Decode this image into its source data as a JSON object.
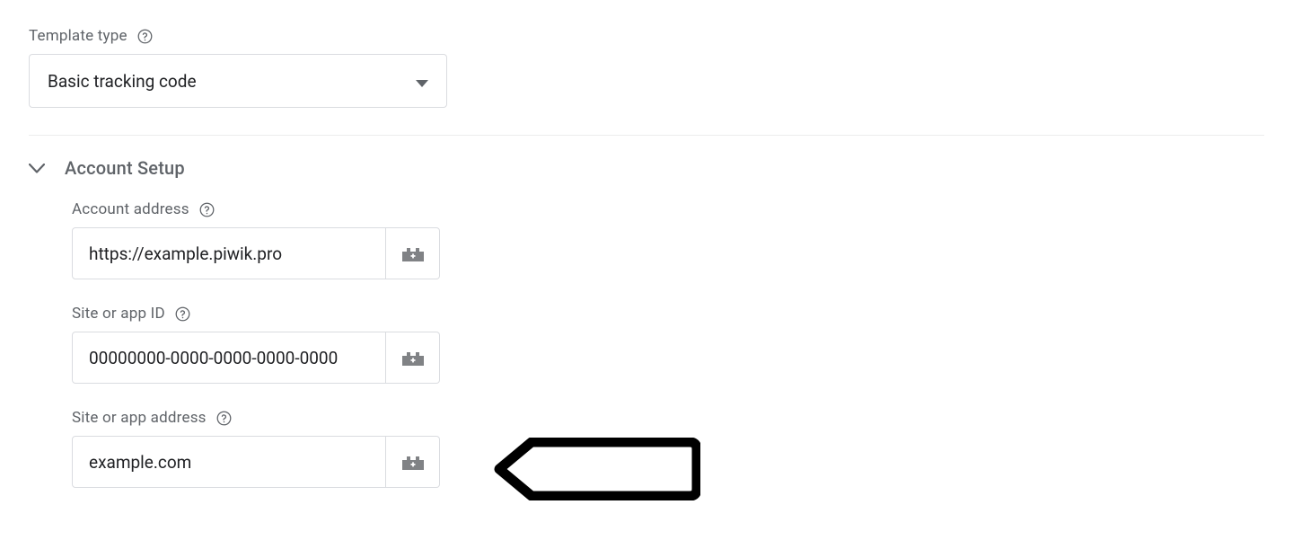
{
  "template_type": {
    "label": "Template type",
    "selected_value": "Basic tracking code"
  },
  "section": {
    "title": "Account Setup",
    "fields": {
      "account_address": {
        "label": "Account address",
        "value": "https://example.piwik.pro"
      },
      "site_or_app_id": {
        "label": "Site or app ID",
        "value": "00000000-0000-0000-0000-0000"
      },
      "site_or_app_address": {
        "label": "Site or app address",
        "value": "example.com"
      }
    }
  }
}
